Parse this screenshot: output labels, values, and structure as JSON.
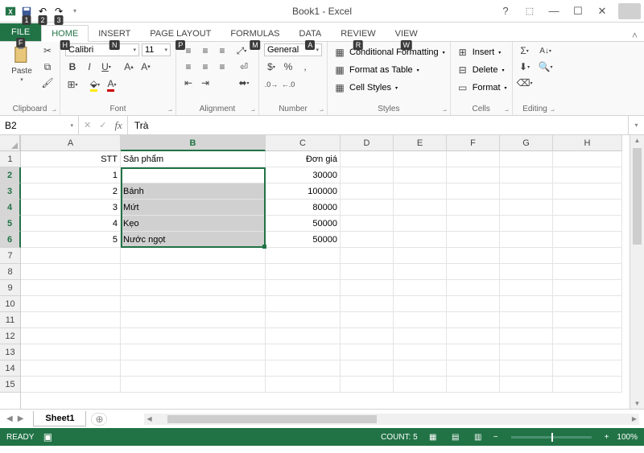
{
  "title": "Book1 - Excel",
  "qat_tips": [
    "1",
    "2",
    "3"
  ],
  "tabs": {
    "file": {
      "label": "FILE",
      "tip": "F"
    },
    "items": [
      {
        "label": "HOME",
        "tip": "H",
        "active": true
      },
      {
        "label": "INSERT",
        "tip": "N"
      },
      {
        "label": "PAGE LAYOUT",
        "tip": "P"
      },
      {
        "label": "FORMULAS",
        "tip": "M"
      },
      {
        "label": "DATA",
        "tip": "A"
      },
      {
        "label": "REVIEW",
        "tip": "R"
      },
      {
        "label": "VIEW",
        "tip": "W"
      }
    ]
  },
  "ribbon": {
    "clipboard": {
      "label": "Clipboard",
      "paste": "Paste"
    },
    "font": {
      "label": "Font",
      "name": "Calibri",
      "size": "11"
    },
    "alignment": {
      "label": "Alignment"
    },
    "number": {
      "label": "Number",
      "format": "General"
    },
    "styles": {
      "label": "Styles",
      "cond": "Conditional Formatting",
      "table": "Format as Table",
      "cell": "Cell Styles"
    },
    "cells": {
      "label": "Cells",
      "insert": "Insert",
      "delete": "Delete",
      "format": "Format"
    },
    "editing": {
      "label": "Editing"
    }
  },
  "namebox": "B2",
  "formula": "Trà",
  "columns": [
    "A",
    "B",
    "C",
    "D",
    "E",
    "F",
    "G",
    "H"
  ],
  "rows": [
    "1",
    "2",
    "3",
    "4",
    "5",
    "6",
    "7",
    "8",
    "9",
    "10",
    "11",
    "12",
    "13",
    "14",
    "15"
  ],
  "selected_rows": [
    2,
    3,
    4,
    5,
    6
  ],
  "data": {
    "headers": {
      "A": "STT",
      "B": "Sản phẩm",
      "C": "Đơn giá"
    },
    "rows": [
      {
        "A": "1",
        "B": "Trà",
        "C": "30000"
      },
      {
        "A": "2",
        "B": "Bánh",
        "C": "100000"
      },
      {
        "A": "3",
        "B": "Mứt",
        "C": "80000"
      },
      {
        "A": "4",
        "B": "Kẹo",
        "C": "50000"
      },
      {
        "A": "5",
        "B": "Nước ngọt",
        "C": "50000"
      }
    ]
  },
  "sheet": "Sheet1",
  "status": {
    "ready": "READY",
    "count": "COUNT: 5",
    "zoom": "100%"
  }
}
